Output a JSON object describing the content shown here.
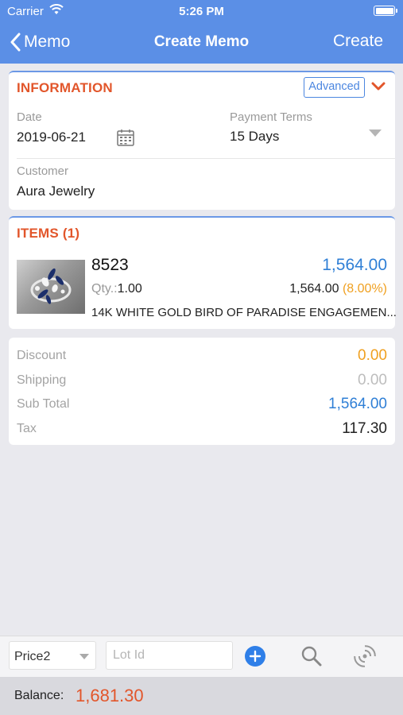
{
  "status": {
    "carrier": "Carrier",
    "time": "5:26 PM"
  },
  "nav": {
    "back_label": "Memo",
    "title": "Create Memo",
    "action_label": "Create"
  },
  "information": {
    "title": "INFORMATION",
    "advanced_label": "Advanced",
    "date_label": "Date",
    "date_value": "2019-06-21",
    "payment_terms_label": "Payment Terms",
    "payment_terms_value": "15 Days",
    "customer_label": "Customer",
    "customer_value": "Aura Jewelry"
  },
  "items": {
    "title": "ITEMS (1)",
    "list": [
      {
        "sku": "8523",
        "total": "1,564.00",
        "qty_label": "Qty.:",
        "qty": "1.00",
        "price": "1,564.00",
        "percent": "(8.00%)",
        "description": "14K WHITE GOLD BIRD OF PARADISE ENGAGEMEN..."
      }
    ]
  },
  "summary": {
    "discount_label": "Discount",
    "discount_value": "0.00",
    "shipping_label": "Shipping",
    "shipping_value": "0.00",
    "subtotal_label": "Sub Total",
    "subtotal_value": "1,564.00",
    "tax_label": "Tax",
    "tax_value": "117.30"
  },
  "toolbar": {
    "price_select": "Price2",
    "lot_placeholder": "Lot Id"
  },
  "balance": {
    "label": "Balance:",
    "amount": "1,681.30"
  },
  "colors": {
    "nav": "#5b8fe6",
    "accent_orange": "#e2562b",
    "accent_blue": "#2f7fd6",
    "amber": "#f0a020"
  }
}
